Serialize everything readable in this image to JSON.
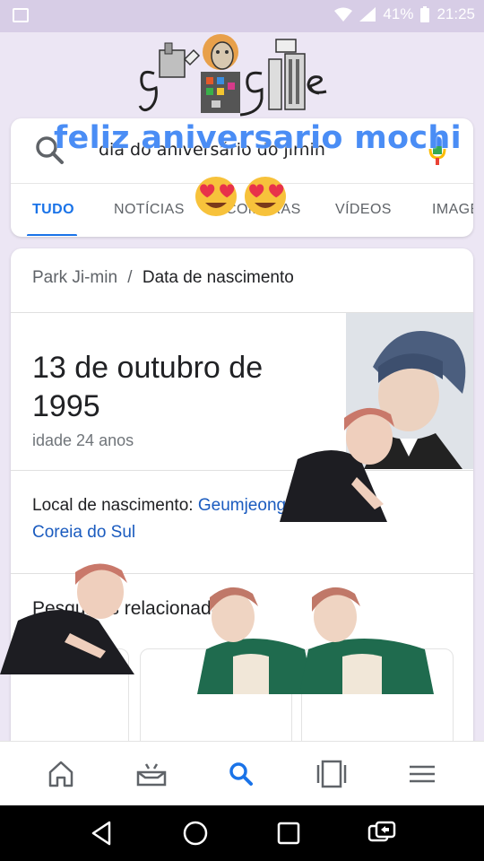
{
  "status_bar": {
    "battery": "41%",
    "time": "21:25"
  },
  "search": {
    "query": "dia do aniversário do jimin",
    "overlay_caption": "feliz aniversario mochi"
  },
  "tabs": [
    {
      "label": "TUDO",
      "active": true
    },
    {
      "label": "NOTÍCIAS",
      "active": false
    },
    {
      "label": "COMPRAS",
      "active": false
    },
    {
      "label": "VÍDEOS",
      "active": false
    },
    {
      "label": "IMAGENS",
      "active": false
    }
  ],
  "knowledge_card": {
    "breadcrumb_entity": "Park Ji-min",
    "breadcrumb_separator": "/",
    "breadcrumb_attribute": "Data de nascimento",
    "birth_date": "13 de outubro de 1995",
    "age": "idade 24 anos",
    "birthplace_label": "Local de nascimento:",
    "birthplace_value_1": "Geumjeong",
    "birthplace_value_2": "Coreia do Sul",
    "related_heading": "Pesquisas relacionadas"
  },
  "bottom_nav": [
    "home-icon",
    "updates-icon",
    "search-icon",
    "tabs-icon",
    "menu-icon"
  ],
  "colors": {
    "accent": "#1a73e8",
    "overlay_text": "#4a8df5",
    "background": "#ece6f4"
  }
}
